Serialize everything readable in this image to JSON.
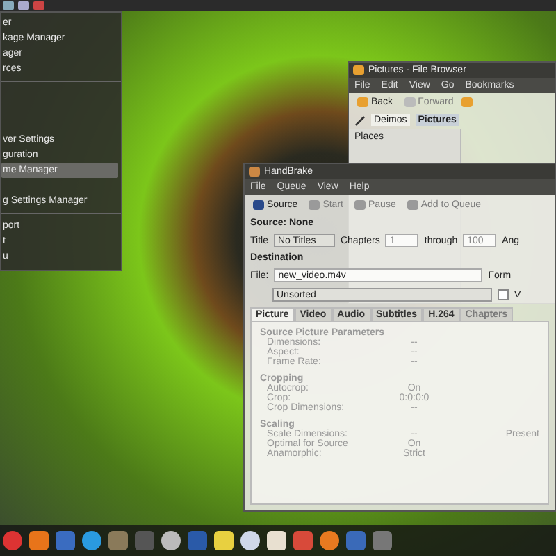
{
  "menu": {
    "items": [
      {
        "kind": "item",
        "label": "er",
        "selected": false
      },
      {
        "kind": "item",
        "label": "kage Manager",
        "selected": false
      },
      {
        "kind": "item",
        "label": "ager",
        "selected": false
      },
      {
        "kind": "item",
        "label": "rces",
        "selected": false
      },
      {
        "kind": "separator"
      },
      {
        "kind": "gap"
      },
      {
        "kind": "gap"
      },
      {
        "kind": "gap"
      },
      {
        "kind": "item",
        "label": "ver Settings",
        "selected": false
      },
      {
        "kind": "item",
        "label": "guration",
        "selected": false
      },
      {
        "kind": "item",
        "label": "me Manager",
        "selected": true
      },
      {
        "kind": "gap"
      },
      {
        "kind": "item",
        "label": "g Settings Manager",
        "selected": false
      },
      {
        "kind": "separator"
      },
      {
        "kind": "item",
        "label": "port",
        "selected": false
      },
      {
        "kind": "item",
        "label": "t",
        "selected": false
      },
      {
        "kind": "item",
        "label": "u",
        "selected": false
      }
    ]
  },
  "file_browser": {
    "title": "Pictures - File Browser",
    "menu": [
      "File",
      "Edit",
      "View",
      "Go",
      "Bookmarks"
    ],
    "nav": [
      {
        "label": "Back",
        "disabled": false
      },
      {
        "label": "Forward",
        "disabled": true
      }
    ],
    "path": [
      {
        "label": "Deimos",
        "selected": false
      },
      {
        "label": "Pictures",
        "selected": true
      }
    ],
    "sidebar_header": "Places"
  },
  "handbrake": {
    "title": "HandBrake",
    "menu": [
      "File",
      "Queue",
      "View",
      "Help"
    ],
    "toolbar": [
      {
        "label": "Source",
        "disabled": false
      },
      {
        "label": "Start",
        "disabled": true
      },
      {
        "label": "Pause",
        "disabled": true
      },
      {
        "label": "Add to Queue",
        "disabled": true
      }
    ],
    "source": "Source: None",
    "title_label": "Title",
    "title_value": "No Titles",
    "chapters_label": "Chapters",
    "chapter_from": "1",
    "through_label": "through",
    "chapter_to": "100",
    "angle_label": "Ang",
    "destination": "Destination",
    "file_label": "File:",
    "file_value": "new_video.m4v",
    "format_label": "Form",
    "folder": "Unsorted",
    "checkbox": {
      "label": "V",
      "checked": false
    },
    "tabs": [
      {
        "label": "Picture",
        "selected": true,
        "disabled": false
      },
      {
        "label": "Video",
        "selected": false,
        "disabled": false
      },
      {
        "label": "Audio",
        "selected": false,
        "disabled": false
      },
      {
        "label": "Subtitles",
        "selected": false,
        "disabled": false
      },
      {
        "label": "H.264",
        "selected": false,
        "disabled": false
      },
      {
        "label": "Chapters",
        "selected": false,
        "disabled": true
      }
    ],
    "sections": [
      {
        "title": "Source Picture Parameters",
        "rows": [
          {
            "label": "Dimensions:",
            "value": "--"
          },
          {
            "label": "Aspect:",
            "value": "--"
          },
          {
            "label": "Frame Rate:",
            "value": "--"
          }
        ]
      },
      {
        "title": "Cropping",
        "rows": [
          {
            "label": "Autocrop:",
            "value": "On"
          },
          {
            "label": "Crop:",
            "value": "0:0:0:0"
          },
          {
            "label": "Crop Dimensions:",
            "value": "--"
          }
        ]
      },
      {
        "title": "Scaling",
        "rows": [
          {
            "label": "Scale Dimensions:",
            "value": "--",
            "extra": "Present"
          },
          {
            "label": "Optimal for Source",
            "value": "On"
          },
          {
            "label": "Anamorphic:",
            "value": "Strict"
          }
        ]
      }
    ]
  }
}
